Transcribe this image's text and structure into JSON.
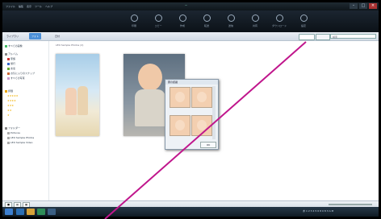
{
  "title_bar": {
    "menus": [
      "ファイル",
      "編集",
      "表示",
      "ツール",
      "ヘルプ"
    ],
    "title": "ー"
  },
  "ribbon": {
    "tools": [
      {
        "label": "印刷"
      },
      {
        "label": "コピー"
      },
      {
        "label": "作成"
      },
      {
        "label": "転送"
      },
      {
        "label": "送信"
      },
      {
        "label": "共有"
      },
      {
        "label": "ダウンロード"
      },
      {
        "label": "設定"
      }
    ]
  },
  "nav": {
    "tabs": [
      "ライブラリ",
      "フォト",
      "日付"
    ],
    "search_placeholder": "検索"
  },
  "sidebar": {
    "items": [
      {
        "label": "すべての画像",
        "color": "#4b6"
      },
      {
        "label": "アルバム",
        "color": "#888"
      },
      {
        "label": "家族",
        "color": "#c33"
      },
      {
        "label": "旅行",
        "color": "#36c"
      },
      {
        "label": "友達",
        "color": "#6a3"
      },
      {
        "label": "お気に入りのスナップ",
        "color": "#c63"
      },
      {
        "label": "すべての写真",
        "color": "#c9c"
      },
      {
        "label": "評価",
        "color": "#e9a400"
      },
      {
        "label": "★★★★★",
        "color": "#f0b000"
      },
      {
        "label": "★★★★",
        "color": "#f0b000"
      },
      {
        "label": "★★★",
        "color": "#f0b000"
      },
      {
        "label": "★★",
        "color": "#f0b000"
      },
      {
        "label": "★",
        "color": "#f0b000"
      },
      {
        "label": "フォルダー",
        "color": "#888"
      },
      {
        "label": "Pictures",
        "color": "#aaa"
      },
      {
        "label": "LEO Sample Photos",
        "color": "#aaa"
      },
      {
        "label": "LEO Sample Video",
        "color": "#aaa"
      }
    ]
  },
  "main": {
    "breadcrumb": "LEO Sample Photos  (2)"
  },
  "dialog": {
    "title": "顔の認識",
    "ok_label": "OK"
  },
  "statusbar": {
    "buttons": [
      "■",
      "▤",
      "▦"
    ]
  },
  "taskbar": {
    "tray_text": "あ 1 2 3 4 5 6 8 0 8 3 A M"
  },
  "colors": {
    "accent": "#4b8fd6",
    "annotation_line": "#c0168c"
  }
}
